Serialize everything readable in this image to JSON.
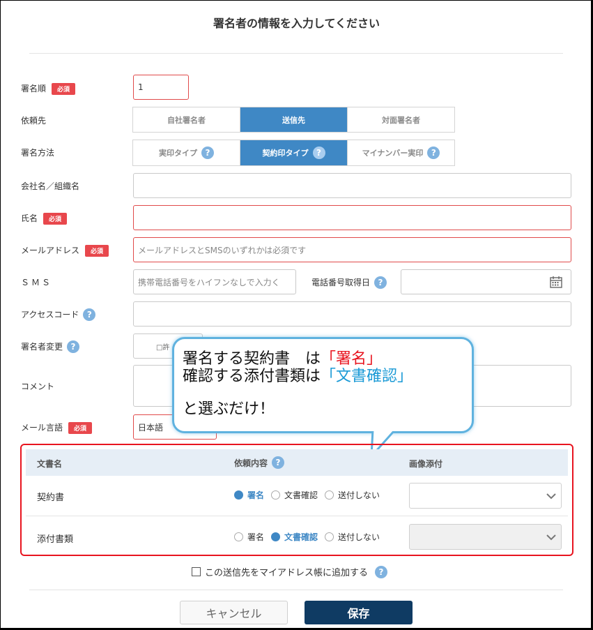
{
  "dialog": {
    "title": "署名者の情報を入力してください"
  },
  "required_badge": "必須",
  "fields": {
    "order": {
      "label": "署名順",
      "value": "1"
    },
    "requestee": {
      "label": "依頼先",
      "options": [
        "自社署名者",
        "送信先",
        "対面署名者"
      ],
      "selected": "送信先"
    },
    "method": {
      "label": "署名方法",
      "options": [
        "実印タイプ",
        "契約印タイプ",
        "マイナンバー実印"
      ],
      "selected": "契約印タイプ"
    },
    "company": {
      "label": "会社名／組織名",
      "value": ""
    },
    "name": {
      "label": "氏名",
      "value": ""
    },
    "email": {
      "label": "メールアドレス",
      "placeholder": "メールアドレスとSMSのいずれかは必須です"
    },
    "sms": {
      "label": "ＳＭＳ",
      "placeholder": "携帯電話番号をハイフンなしで入力く"
    },
    "phone_date": {
      "label": "電話番号取得日"
    },
    "access_code": {
      "label": "アクセスコード"
    },
    "signer_change": {
      "label": "署名者変更",
      "partial_text": "□許"
    },
    "comment": {
      "label": "コメント"
    },
    "mail_language": {
      "label": "メール言語",
      "value": "日本語"
    }
  },
  "doc_table": {
    "headers": [
      "文書名",
      "依頼内容",
      "画像添付"
    ],
    "options": [
      "署名",
      "文書確認",
      "送付しない"
    ],
    "rows": [
      {
        "name": "契約書",
        "selected": "署名"
      },
      {
        "name": "添付書類",
        "selected": "文書確認"
      }
    ]
  },
  "callout": {
    "line1_prefix": "署名する契約書　は",
    "line1_highlight": "「署名」",
    "line2_prefix": "確認する添付書類は",
    "line2_highlight": "「文書確認」",
    "line3": "と選ぶだけ！",
    "colors": {
      "red": "#e8141f",
      "blue": "#1a9ad6",
      "border": "#5fb2df"
    }
  },
  "address_book": {
    "label": "この送信先をマイアドレス帳に追加する"
  },
  "buttons": {
    "cancel": "キャンセル",
    "save": "保存"
  },
  "colors": {
    "accent": "#3f88c5",
    "required": "#e8474c",
    "save": "#0f3b63",
    "highlight_border": "#e8141f"
  }
}
